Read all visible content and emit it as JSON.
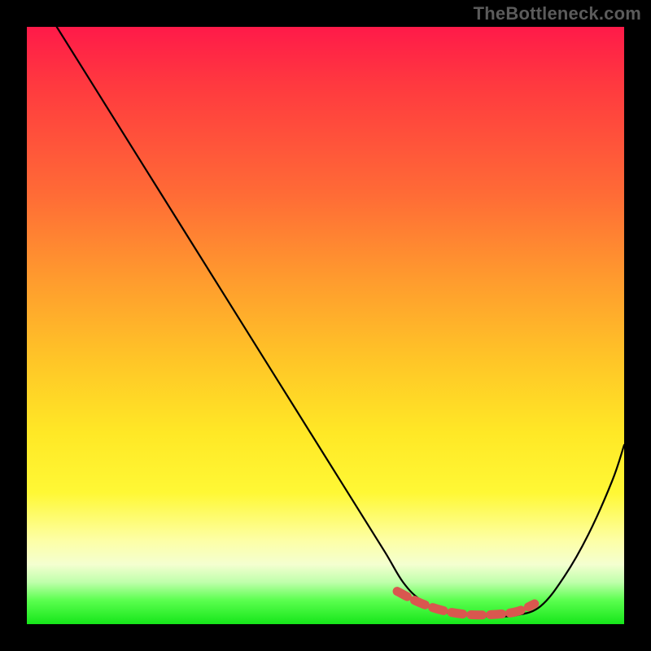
{
  "watermark": "TheBottleneck.com",
  "colors": {
    "background": "#000000",
    "curve": "#000000",
    "emphasis": "#d9574f",
    "watermark": "#5b5b5b"
  },
  "chart_data": {
    "type": "line",
    "title": "",
    "xlabel": "",
    "ylabel": "",
    "xlim": [
      0,
      100
    ],
    "ylim": [
      0,
      100
    ],
    "grid": false,
    "legend": false,
    "series": [
      {
        "name": "bottleneck-curve",
        "x": [
          5,
          10,
          15,
          20,
          25,
          30,
          35,
          40,
          45,
          50,
          55,
          60,
          63,
          66,
          70,
          74,
          78,
          82,
          86,
          90,
          94,
          98,
          100
        ],
        "y": [
          100,
          92,
          84,
          76,
          68,
          60,
          52,
          44,
          36,
          28,
          20,
          12,
          7,
          4,
          2,
          1.5,
          1.3,
          1.5,
          3,
          8,
          15,
          24,
          30
        ]
      }
    ],
    "emphasis_segment": {
      "name": "min-plateau",
      "x": [
        62,
        66,
        70,
        74,
        78,
        82,
        85
      ],
      "y": [
        5.5,
        3.5,
        2.2,
        1.6,
        1.6,
        2.1,
        3.4
      ]
    },
    "gradient_zones": {
      "top_color": "#ff1a49",
      "mid_color": "#ffe826",
      "bottom_color": "#16e61a"
    }
  }
}
